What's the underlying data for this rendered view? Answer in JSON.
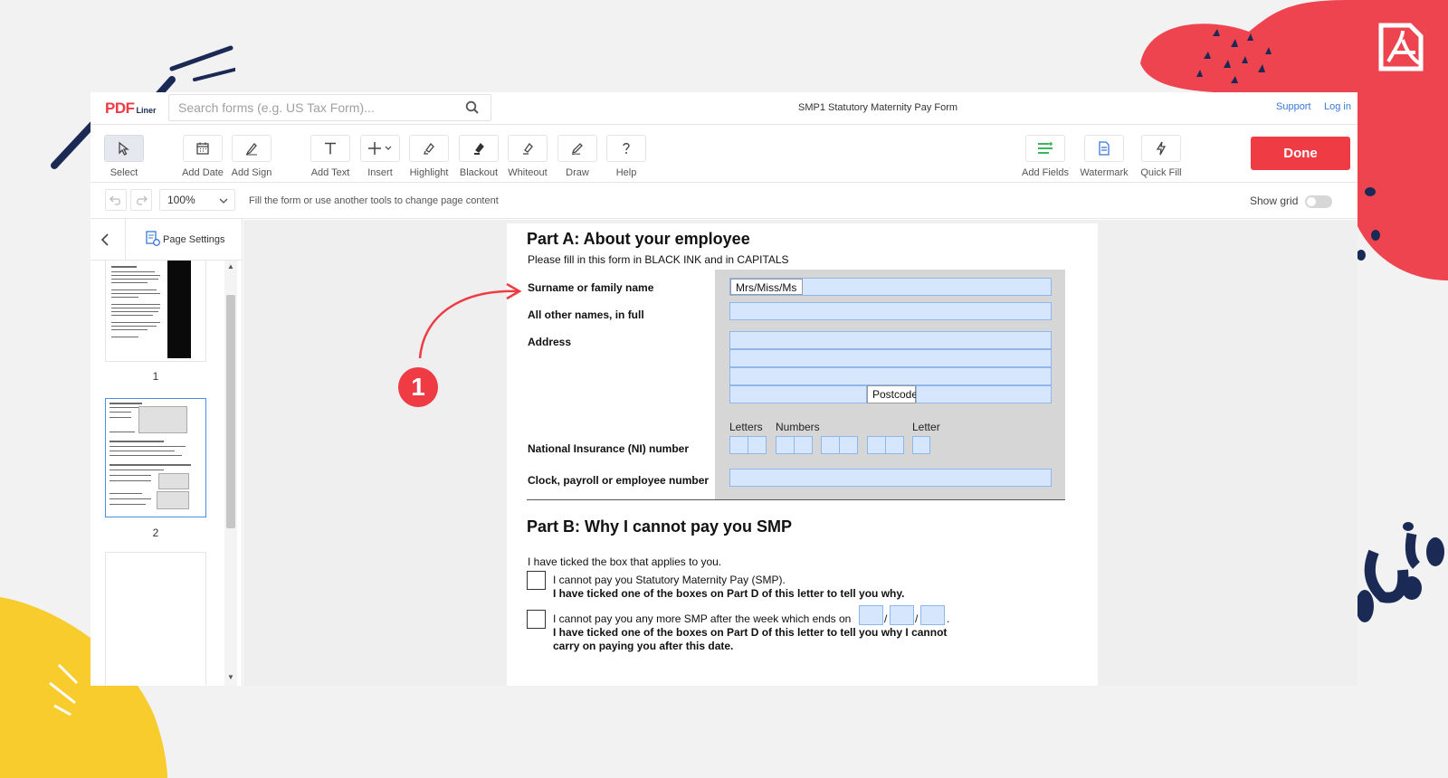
{
  "colors": {
    "accent": "#ee3b44",
    "link": "#3a78d6",
    "field_fill": "#d6e6fc",
    "field_border": "#8fb6ea",
    "form_grey": "#d6d6d6"
  },
  "header": {
    "logo_text": "PDF",
    "logo_sub": "Liner",
    "search_placeholder": "Search forms (e.g. US Tax Form)...",
    "doc_title": "SMP1 Statutory Maternity Pay Form",
    "support": "Support",
    "login": "Log in"
  },
  "toolbar": {
    "tools": [
      {
        "label": "Select",
        "icon": "cursor-icon"
      },
      {
        "label": "Add Date",
        "icon": "calendar-icon"
      },
      {
        "label": "Add Sign",
        "icon": "pen-icon"
      },
      {
        "label": "Add Text",
        "icon": "text-icon"
      },
      {
        "label": "Insert",
        "icon": "plus-icon"
      },
      {
        "label": "Highlight",
        "icon": "highlighter-icon"
      },
      {
        "label": "Blackout",
        "icon": "blackout-icon"
      },
      {
        "label": "Whiteout",
        "icon": "eraser-icon"
      },
      {
        "label": "Draw",
        "icon": "pencil-icon"
      },
      {
        "label": "Help",
        "icon": "help-icon"
      }
    ],
    "right_tools": [
      {
        "label": "Add Fields",
        "icon": "fields-icon"
      },
      {
        "label": "Watermark",
        "icon": "watermark-icon"
      },
      {
        "label": "Quick Fill",
        "icon": "lightning-icon"
      }
    ],
    "done": "Done"
  },
  "subbar": {
    "zoom": "100%",
    "hint": "Fill the form or use another tools to change page content",
    "show_grid": "Show grid"
  },
  "sidebar": {
    "page_settings": "Page Settings",
    "pages": [
      "1",
      "2"
    ]
  },
  "form": {
    "partA_title": "Part A: About your employee",
    "partA_sub": "Please fill in this form in BLACK INK and in CAPITALS",
    "surname_label": "Surname or family name",
    "title_prefix": "Mrs/Miss/Ms",
    "other_names_label": "All other names, in full",
    "address_label": "Address",
    "postcode": "Postcode",
    "ni_letters": "Letters",
    "ni_numbers": "Numbers",
    "ni_letter": "Letter",
    "ni_label": "National Insurance (NI) number",
    "clock_label": "Clock, payroll or employee number",
    "partB_title": "Part B: Why I cannot pay you SMP",
    "partB_intro": "I have ticked the box that applies to you.",
    "opt1_line1": "I cannot pay you Statutory Maternity Pay (SMP).",
    "opt1_line2": "I have ticked one of the boxes on Part D of this letter to tell you why.",
    "opt2_line1": "I cannot pay you any more SMP after the week which ends on",
    "opt2_line2": "I have ticked one of the boxes on Part D of this letter to tell you why I cannot",
    "opt2_line3": "carry on paying you after this date.",
    "date_sep": "/",
    "period": "."
  },
  "annotation": {
    "marker": "1"
  }
}
